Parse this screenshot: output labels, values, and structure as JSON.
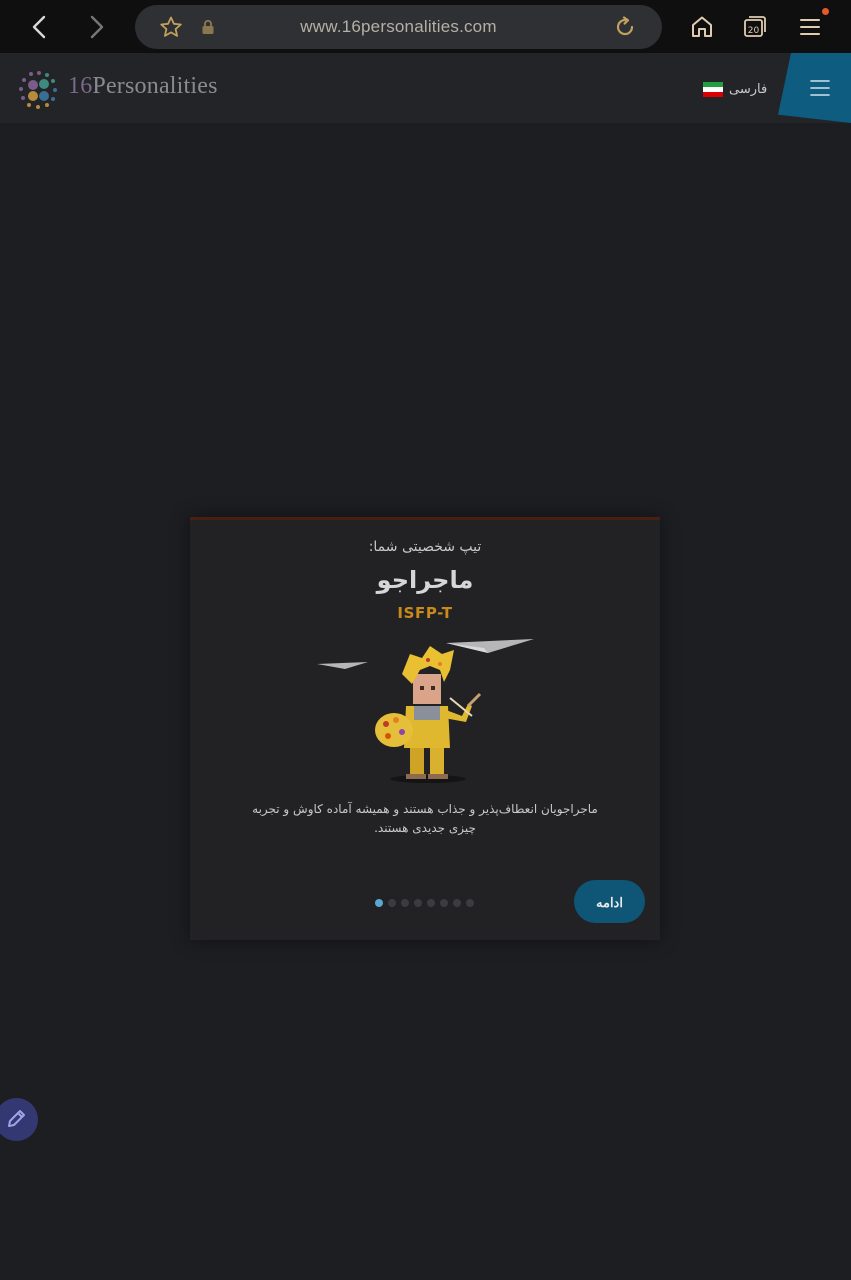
{
  "browser": {
    "url": "www.16personalities.com",
    "tabs_count": "20",
    "icons": [
      "back-icon",
      "forward-icon",
      "star-icon",
      "lock-icon",
      "reload-icon",
      "home-icon",
      "tabs-icon",
      "menu-icon"
    ]
  },
  "header": {
    "logo_number": "16",
    "logo_word": "Personalities",
    "language_label": "فارسی",
    "flag_colors": [
      "#239f40",
      "#ffffff",
      "#da0000"
    ]
  },
  "card": {
    "label": "تیپ شخصیتی شما:",
    "type_name": "ماجراجو",
    "type_code": "ISFP-T",
    "description": "ماجراجویان انعطاف‌پذیر و جذاب هستند و همیشه آماده کاوش و تجربه چیزی جدیدی هستند.",
    "continue_label": "ادامه",
    "pagination": {
      "total": 8,
      "current": 1
    }
  },
  "colors": {
    "accent": "#0e5c80",
    "type_code": "#c98a1c",
    "active_dot": "#5aa8d2"
  }
}
